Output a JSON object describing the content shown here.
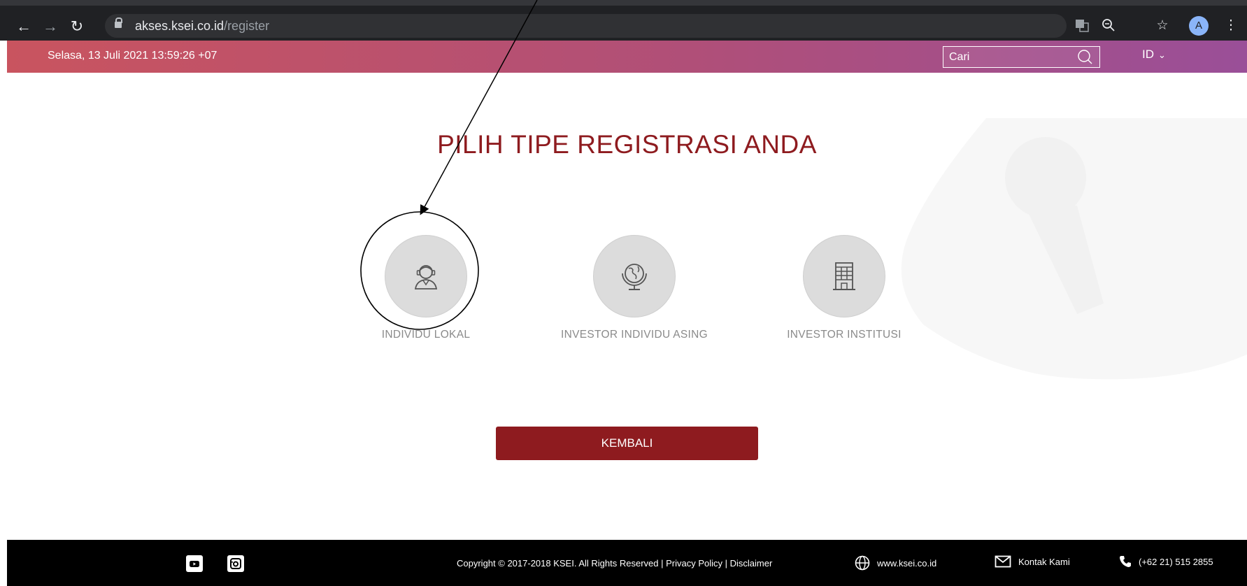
{
  "browser": {
    "url_domain": "akses.ksei.co.id",
    "url_path": "/register",
    "avatar_letter": "A"
  },
  "header": {
    "datetime": "Selasa, 13 Juli 2021 13:59:26 +07",
    "search_placeholder": "Cari",
    "language": "ID"
  },
  "main": {
    "title": "PILIH TIPE REGISTRASI ANDA",
    "options": [
      {
        "label": "INDIVIDU LOKAL",
        "icon": "person-icon"
      },
      {
        "label": "INVESTOR INDIVIDU ASING",
        "icon": "globe-icon"
      },
      {
        "label": "INVESTOR INSTITUSI",
        "icon": "building-icon"
      }
    ],
    "back_button": "KEMBALI"
  },
  "footer": {
    "copyright": "Copyright © 2017-2018 KSEI. All Rights Reserved | Privacy Policy | Disclaimer",
    "website": "www.ksei.co.id",
    "contact": "Kontak Kami",
    "phone": "(+62 21) 515 2855"
  },
  "colors": {
    "brand": "#8e1b1f",
    "header_start": "#c9545f",
    "header_end": "#9a4f98"
  }
}
